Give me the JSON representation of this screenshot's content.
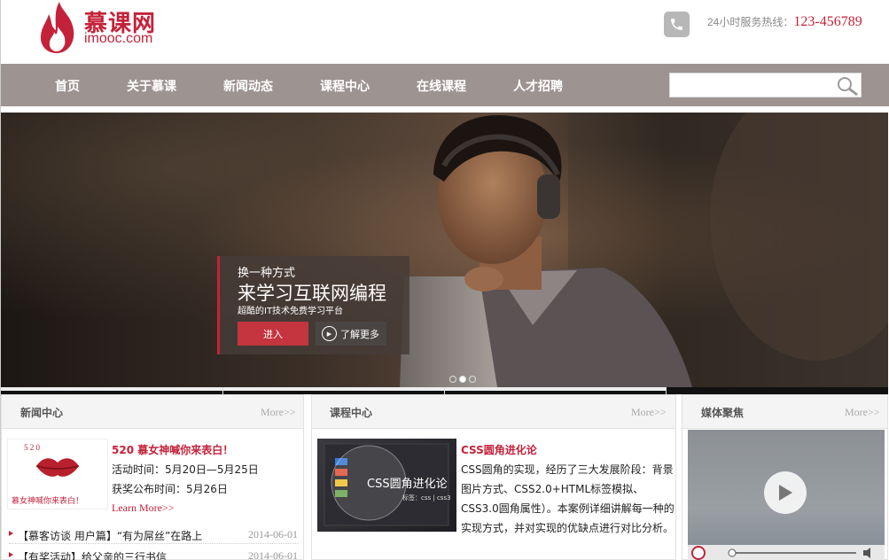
{
  "brand": {
    "name_cn": "慕课网",
    "name_en": "imooc.com"
  },
  "header": {
    "hotline_label": "24小时服务热线：",
    "hotline_number": "123-456789"
  },
  "nav": {
    "items": [
      {
        "label": "首页"
      },
      {
        "label": "关于慕课"
      },
      {
        "label": "新闻动态"
      },
      {
        "label": "课程中心"
      },
      {
        "label": "在线课程"
      },
      {
        "label": "人才招聘"
      }
    ],
    "search_placeholder": ""
  },
  "banner": {
    "line1": "换一种方式",
    "line2": "来学习互联网编程",
    "line3": "超酷的IT技术免费学习平台",
    "enter_label": "进入",
    "more_label": "了解更多",
    "slides": 3,
    "active_slide": 2
  },
  "news": {
    "title": "新闻中心",
    "more": "More>>",
    "featured_title": "520 慕女神喊你来表白！",
    "featured_lines": [
      "活动时间：5月20日—5月25日",
      "获奖公布时间：5月26日"
    ],
    "featured_link": "Learn More>>",
    "image_text_top": "5 2 0",
    "image_text_bottom": "慕女神喊你来表白！",
    "items": [
      {
        "text": "【慕客访谈 用户篇】“有为屌丝”在路上",
        "date": "2014-06-01"
      },
      {
        "text": "【有奖活动】给父亲的三行书信",
        "date": "2014-06-01"
      }
    ]
  },
  "courses": {
    "title": "课程中心",
    "more": "More>>",
    "featured_title": "CSS圆角进化论",
    "featured_desc": "CSS圆角的实现，经历了三大发展阶段：背景图片方式、CSS2.0+HTML标签模拟、CSS3.0圆角属性）。本案例详细讲解每一种的实现方式，并对实现的优缺点进行对比分析。",
    "image_caption": "CSS圆角进化论",
    "image_tags": "标签：css | css3"
  },
  "media": {
    "title": "媒体聚焦",
    "more": "More>>"
  },
  "colors": {
    "brand_red": "#c4223a",
    "nav_bg": "#9d9391"
  }
}
